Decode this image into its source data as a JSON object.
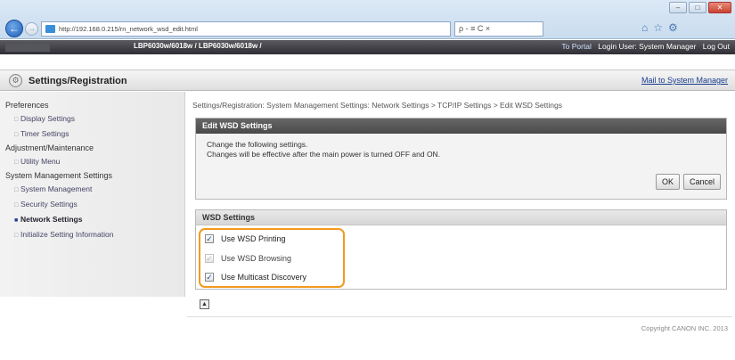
{
  "browser": {
    "address": "http://192.168.0.215/rn_network_wsd_edit.html",
    "search_text": "ρ - ≡ C ×",
    "window_controls": [
      "–",
      "□",
      "✕"
    ],
    "toolbar_icons": [
      "⌂",
      "☆",
      "⚙"
    ]
  },
  "header": {
    "device_name": "LBP6030w/6018w / LBP6030w/6018w /",
    "portal_link": "To Portal",
    "login_user": "Login User: System Manager",
    "logout": "Log Out"
  },
  "title_bar": {
    "title": "Settings/Registration",
    "mail_link": "Mail to System Manager"
  },
  "sidebar": {
    "preferences": "Preferences",
    "display_settings": "Display Settings",
    "timer_settings": "Timer Settings",
    "adjustment": "Adjustment/Maintenance",
    "utility_menu": "Utility Menu",
    "system_mgmt": "System Management Settings",
    "system_management": "System Management",
    "security_settings": "Security Settings",
    "network_settings": "Network Settings",
    "initialize": "Initialize Setting Information"
  },
  "breadcrumb": "Settings/Registration: System Management Settings: Network Settings > TCP/IP Settings > Edit WSD Settings",
  "edit_panel": {
    "title": "Edit WSD Settings",
    "line1": "Change the following settings.",
    "line2": "Changes will be effective after the main power is turned OFF and ON.",
    "ok": "OK",
    "cancel": "Cancel"
  },
  "wsd_panel": {
    "title": "WSD Settings",
    "options": [
      {
        "label": "Use WSD Printing",
        "checked": true,
        "enabled": true
      },
      {
        "label": "Use WSD Browsing",
        "checked": true,
        "enabled": false
      },
      {
        "label": "Use Multicast Discovery",
        "checked": true,
        "enabled": true
      }
    ]
  },
  "copyright": "Copyright CANON INC. 2013",
  "colors": {
    "highlight": "#f29a1f",
    "header_dark": "#3a3a40",
    "link": "#1a3f8f"
  }
}
